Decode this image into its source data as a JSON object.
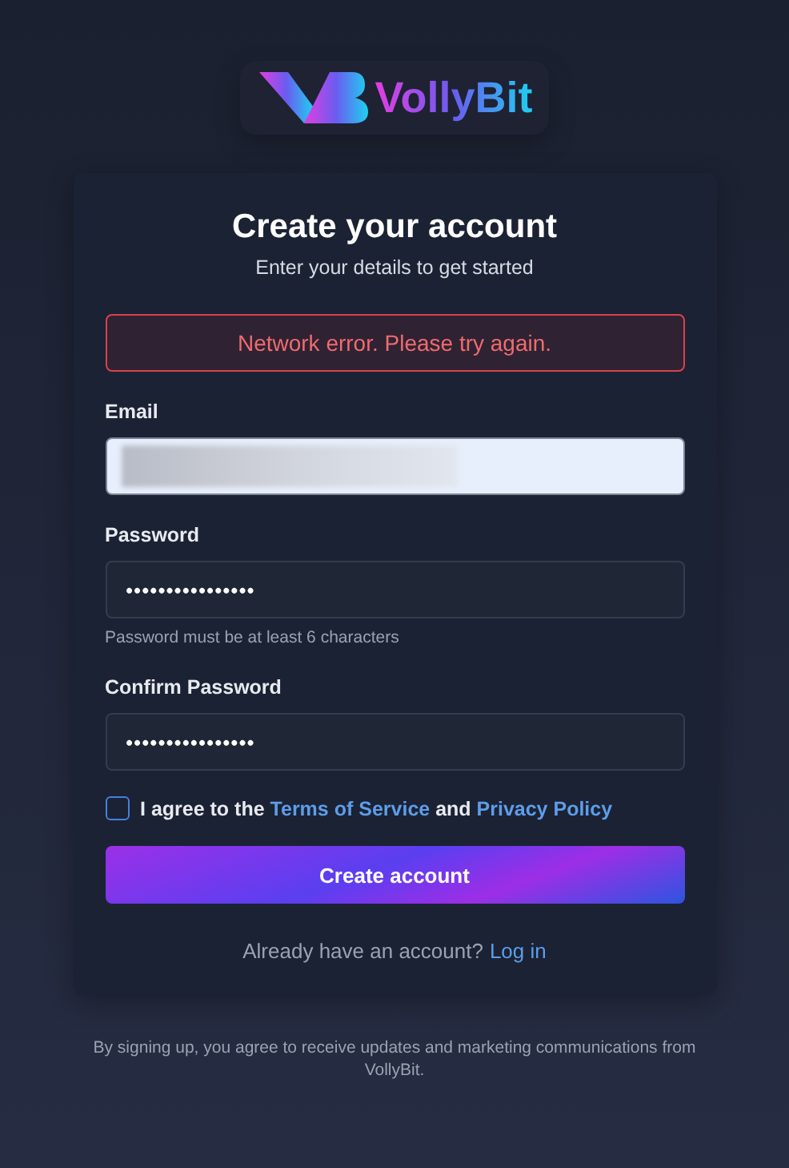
{
  "logo": {
    "name": "VollyBit"
  },
  "form": {
    "title": "Create your account",
    "subtitle": "Enter your details to get started",
    "error": "Network error. Please try again.",
    "fields": [
      {
        "label": "Email",
        "kind": "redacted",
        "focused": true
      },
      {
        "label": "Password",
        "kind": "password",
        "value": "••••••••••••••••",
        "hint": "Password must be at least 6 characters",
        "focused": false
      },
      {
        "label": "Confirm Password",
        "kind": "password",
        "value": "••••••••••••••••",
        "focused": false
      }
    ],
    "agreement": {
      "checked": false,
      "parts": [
        {
          "kind": "text",
          "text": "I agree to the "
        },
        {
          "kind": "link",
          "text": "Terms of Service"
        },
        {
          "kind": "text",
          "text": " and "
        },
        {
          "kind": "link",
          "text": "Privacy Policy"
        }
      ]
    },
    "submit": "Create account",
    "login_prompt": "Already have an account?",
    "login_link": "Log in"
  },
  "footer": "By signing up, you agree to receive updates and marketing communications from VollyBit."
}
